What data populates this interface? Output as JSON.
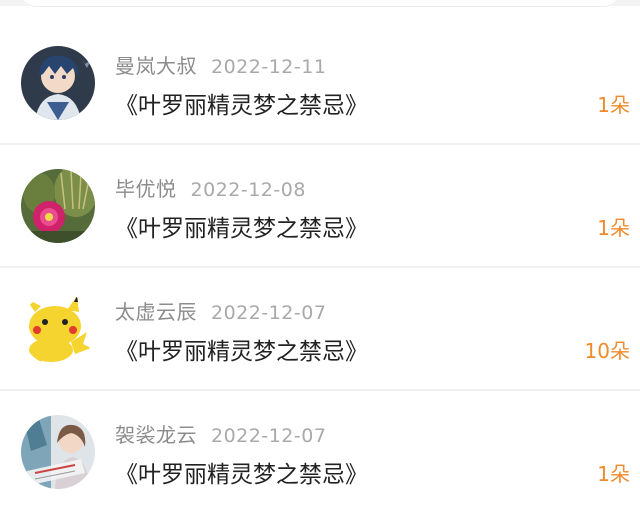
{
  "theme": {
    "accent": "#f08a2c",
    "name_color": "#8c8c8c",
    "date_color": "#a9a9a9",
    "text_color": "#222222"
  },
  "records": [
    {
      "name": "曼岚大叔",
      "date": "2022-12-11",
      "title": "《叶罗丽精灵梦之禁忌》",
      "count": "1朵",
      "avatar": "anime-boy-avatar"
    },
    {
      "name": "毕优悦",
      "date": "2022-12-08",
      "title": "《叶罗丽精灵梦之禁忌》",
      "count": "1朵",
      "avatar": "cactus-flower-avatar"
    },
    {
      "name": "太虚云辰",
      "date": "2022-12-07",
      "title": "《叶罗丽精灵梦之禁忌》",
      "count": "10朵",
      "avatar": "pikachu-avatar"
    },
    {
      "name": "袈裟龙云",
      "date": "2022-12-07",
      "title": "《叶罗丽精灵梦之禁忌》",
      "count": "1朵",
      "avatar": "girl-photo-avatar"
    }
  ]
}
